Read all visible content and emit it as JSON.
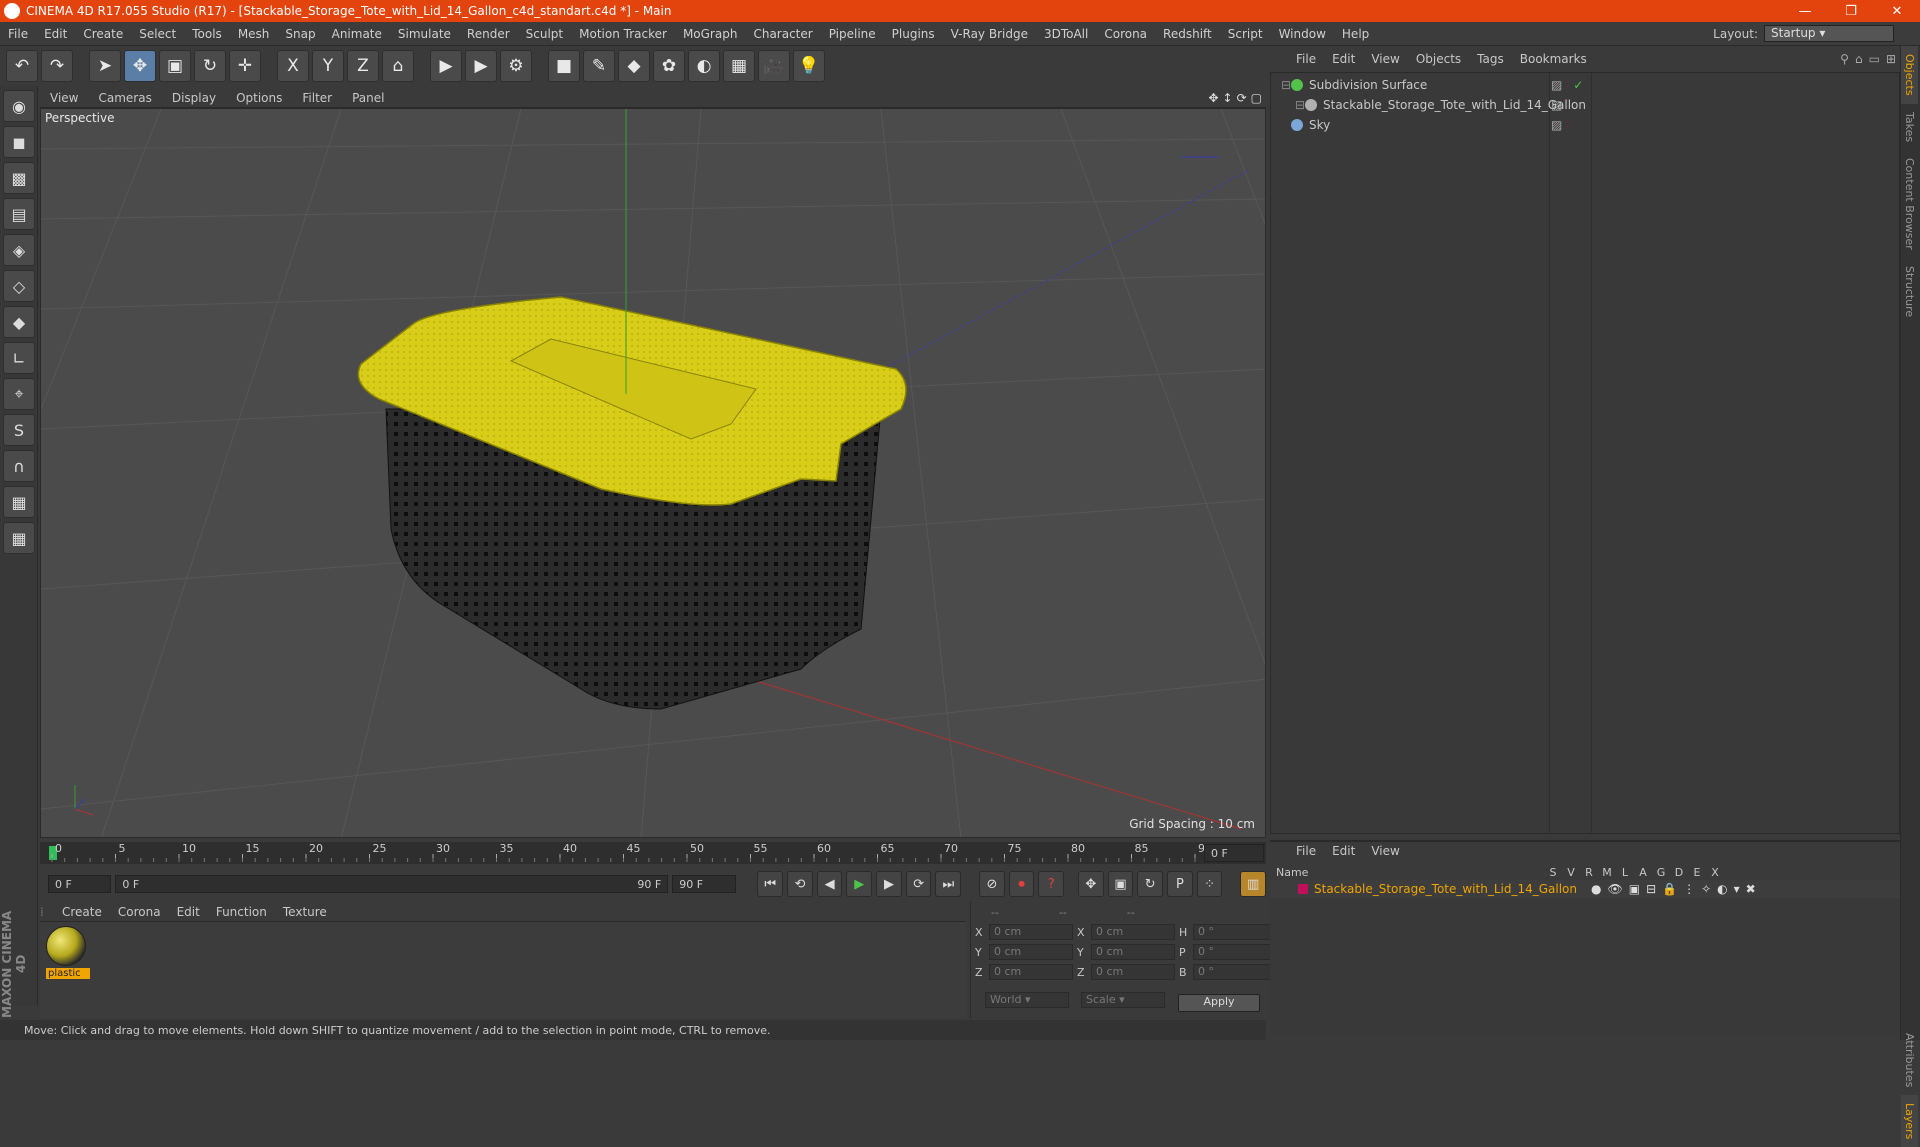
{
  "window": {
    "title": "CINEMA 4D R17.055 Studio (R17) - [Stackable_Storage_Tote_with_Lid_14_Gallon_c4d_standart.c4d *] - Main",
    "controls": [
      "—",
      "❐",
      "✕"
    ]
  },
  "menubar": {
    "items": [
      "File",
      "Edit",
      "Create",
      "Select",
      "Tools",
      "Mesh",
      "Snap",
      "Animate",
      "Simulate",
      "Render",
      "Sculpt",
      "Motion Tracker",
      "MoGraph",
      "Character",
      "Pipeline",
      "Plugins",
      "V-Ray Bridge",
      "3DToAll",
      "Corona",
      "Redshift",
      "Script",
      "Window",
      "Help"
    ],
    "layout_label": "Layout:",
    "layout_value": "Startup"
  },
  "toolbar": {
    "groups": [
      [
        "undo-icon",
        "redo-icon"
      ],
      [
        "select-icon",
        "move-icon",
        "scale-icon",
        "rotate-icon",
        "transform-icon"
      ],
      [
        "x-axis-icon",
        "y-axis-icon",
        "z-axis-icon",
        "coord-system-icon"
      ],
      [
        "render-view-icon",
        "render-picture-viewer-icon",
        "edit-render-settings-icon"
      ],
      [
        "cube-icon",
        "pen-icon",
        "subdivision-icon",
        "mograph-icon",
        "deformer-icon",
        "floor-icon",
        "camera-icon",
        "light-icon"
      ]
    ],
    "glyphs": {
      "undo-icon": "↶",
      "redo-icon": "↷",
      "select-icon": "➤",
      "move-icon": "✥",
      "scale-icon": "▣",
      "rotate-icon": "↻",
      "transform-icon": "✛",
      "x-axis-icon": "X",
      "y-axis-icon": "Y",
      "z-axis-icon": "Z",
      "coord-system-icon": "⌂",
      "render-view-icon": "▶",
      "render-picture-viewer-icon": "▶",
      "edit-render-settings-icon": "⚙",
      "cube-icon": "■",
      "pen-icon": "✎",
      "subdivision-icon": "◆",
      "mograph-icon": "✿",
      "deformer-icon": "◐",
      "floor-icon": "▦",
      "camera-icon": "🎥",
      "light-icon": "💡"
    }
  },
  "left_tools": [
    "make-editable-icon",
    "model-mode-icon",
    "texture-mode-icon",
    "workplane-icon",
    "points-mode-icon",
    "edges-mode-icon",
    "polygons-mode-icon",
    "axis-mode-icon",
    "tweak-mode-icon",
    "solo-icon",
    "snap-icon",
    "workplane-lock-icon",
    "grid-snap-icon"
  ],
  "left_glyphs": {
    "make-editable-icon": "◉",
    "model-mode-icon": "◼",
    "texture-mode-icon": "▩",
    "workplane-icon": "▤",
    "points-mode-icon": "◈",
    "edges-mode-icon": "◇",
    "polygons-mode-icon": "◆",
    "axis-mode-icon": "∟",
    "tweak-mode-icon": "⌖",
    "solo-icon": "S",
    "snap-icon": "∩",
    "workplane-lock-icon": "▦",
    "grid-snap-icon": "▦"
  },
  "viewport": {
    "menu": [
      "View",
      "Cameras",
      "Display",
      "Options",
      "Filter",
      "Panel"
    ],
    "label": "Perspective",
    "grid_spacing": "Grid Spacing : 10 cm"
  },
  "timeline": {
    "ticks": [
      "0",
      "5",
      "10",
      "15",
      "20",
      "25",
      "30",
      "35",
      "40",
      "45",
      "50",
      "55",
      "60",
      "65",
      "70",
      "75",
      "80",
      "85",
      "90"
    ],
    "current_frame": "0 F"
  },
  "transport": {
    "start_field": "0 F",
    "range_start": "0 F",
    "range_end": "90 F",
    "end_field": "90 F"
  },
  "material_manager": {
    "menu": [
      "Create",
      "Corona",
      "Edit",
      "Function",
      "Texture"
    ],
    "materials": [
      {
        "name": "plastic"
      }
    ]
  },
  "coordinates": {
    "header": [
      "--",
      "--",
      "--"
    ],
    "rows": [
      {
        "a": "X",
        "v1": "0 cm",
        "b": "X",
        "v2": "0 cm",
        "c": "H",
        "v3": "0 °"
      },
      {
        "a": "Y",
        "v1": "0 cm",
        "b": "Y",
        "v2": "0 cm",
        "c": "P",
        "v3": "0 °"
      },
      {
        "a": "Z",
        "v1": "0 cm",
        "b": "Z",
        "v2": "0 cm",
        "c": "B",
        "v3": "0 °"
      }
    ],
    "world": "World",
    "scale": "Scale",
    "apply": "Apply"
  },
  "status": {
    "text": "Move: Click and drag to move elements. Hold down SHIFT to quantize movement / add to the selection in point mode, CTRL to remove."
  },
  "brand": "MAXON CINEMA 4D",
  "object_manager": {
    "menu": [
      "File",
      "Edit",
      "View",
      "Objects",
      "Tags",
      "Bookmarks"
    ],
    "objects": [
      {
        "name": "Subdivision Surface",
        "color": "#52c24a",
        "indent": 0
      },
      {
        "name": "Stackable_Storage_Tote_with_Lid_14_Gallon",
        "color": "#b0b0b0",
        "indent": 1
      },
      {
        "name": "Sky",
        "color": "#7aa7d8",
        "indent": 0
      }
    ]
  },
  "layer_manager": {
    "menu": [
      "File",
      "Edit",
      "View"
    ],
    "columns": [
      "Name",
      "S",
      "V",
      "R",
      "M",
      "L",
      "A",
      "G",
      "D",
      "E",
      "X"
    ],
    "layers": [
      {
        "name": "Stackable_Storage_Tote_with_Lid_14_Gallon",
        "color": "#c0105a"
      }
    ]
  },
  "side_tabs": [
    "Objects",
    "Takes",
    "Content Browser",
    "Structure",
    "Attributes",
    "Layers"
  ],
  "colors": {
    "accent": "#e3440e",
    "layer_text": "#f0a500"
  }
}
